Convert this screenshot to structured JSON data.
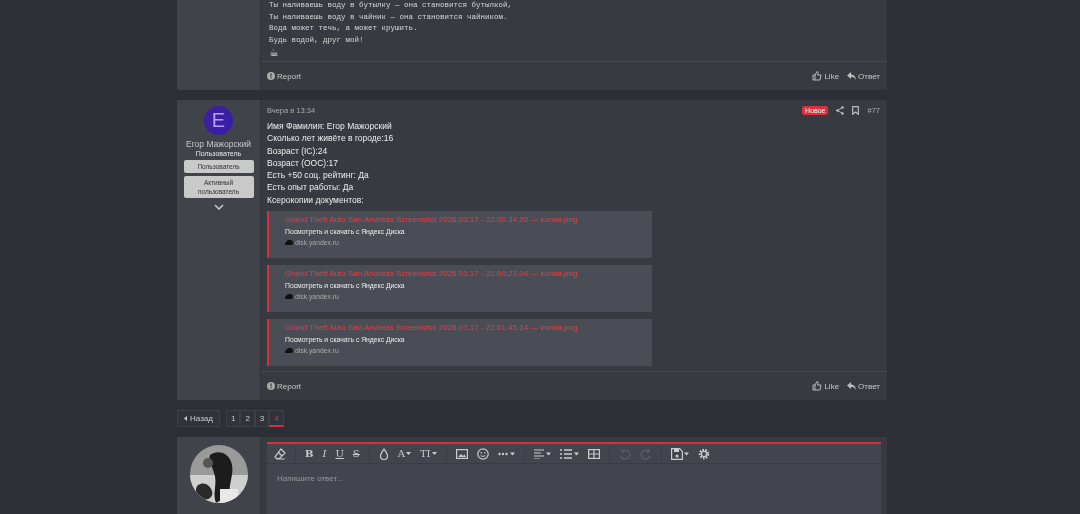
{
  "previous_post": {
    "lines": [
      "Ты наливаешь воду в бутылку — она становится бутылкой,",
      "Ты наливаешь воду в чайник — она становится чайником.",
      "Вода может течь, а может крушить.",
      "Будь водой, друг мой!"
    ],
    "emoji": "☕",
    "report": "Report",
    "like": "Like",
    "reply": "Ответ"
  },
  "post": {
    "author": {
      "initial": "E",
      "name": "Егор Мажорский",
      "title": "Пользователь",
      "banners": [
        "Пользователь",
        "Активный пользователь"
      ]
    },
    "time": "Вчера в 13:34",
    "badge": "Новое",
    "number": "#77",
    "lines": [
      "Имя Фамилия: Егор Мажорский",
      "Сколько лет живёте в городе:16",
      "Возраст (IC):24",
      "Возраст (OOC):17",
      "Есть +50 соц. рейтинг: Да",
      "Есть опыт работы: Да",
      "Ксерокопии документов:"
    ],
    "embeds": [
      {
        "title": "Grand Theft Auto San Andreas Screenshot 2026.03.17 - 22.00.34.20 — копия.png",
        "description": "Посмотреть и скачать с Яндекс Диска",
        "domain": "disk.yandex.ru"
      },
      {
        "title": "Grand Theft Auto San Andreas Screenshot 2026.03.17 - 22.00.23.04 — копия.png",
        "description": "Посмотреть и скачать с Яндекс Диска",
        "domain": "disk.yandex.ru"
      },
      {
        "title": "Grand Theft Auto San Andreas Screenshot 2026.03.17 - 22.01.45.14 — копия.png",
        "description": "Посмотреть и скачать с Яндекс Диска",
        "domain": "disk.yandex.ru"
      }
    ],
    "report": "Report",
    "like": "Like",
    "reply": "Ответ"
  },
  "pagination": {
    "back": "Назад",
    "pages": [
      {
        "label": "1",
        "selected": false
      },
      {
        "label": "2",
        "selected": false
      },
      {
        "label": "3",
        "selected": false
      },
      {
        "label": "4",
        "selected": true
      }
    ]
  },
  "editor": {
    "toolbar": {
      "bold": "B",
      "italic": "I",
      "underline": "U",
      "strike": "S",
      "text_color": "A",
      "text_size": "TI",
      "undo_disabled": true,
      "redo_disabled": true
    },
    "placeholder": "Напишите ответ..."
  }
}
